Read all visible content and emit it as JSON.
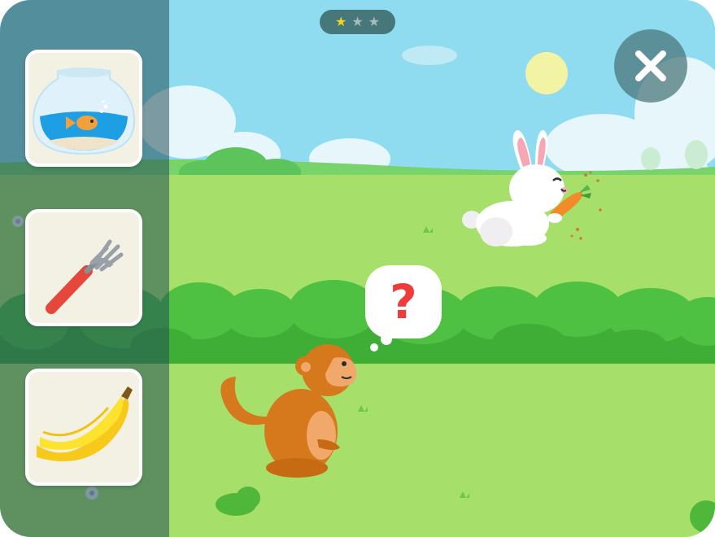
{
  "game": {
    "progress": {
      "earned": 1,
      "total": 3
    },
    "colors": {
      "star_on": "#f7d21d",
      "star_off": "#a9bcbc",
      "sky": "#8fdcf0",
      "grass": "#a6e06a",
      "bush": "#4fc142"
    },
    "choices": [
      {
        "icon": "fishbowl-icon",
        "item": "fishbowl"
      },
      {
        "icon": "fork-icon",
        "item": "fork"
      },
      {
        "icon": "banana-icon",
        "item": "banana"
      }
    ],
    "characters": {
      "thinker": "monkey",
      "example": "rabbit",
      "example_food": "carrot"
    },
    "thought_bubble": {
      "text": "?"
    },
    "close_icon": "close-icon"
  }
}
